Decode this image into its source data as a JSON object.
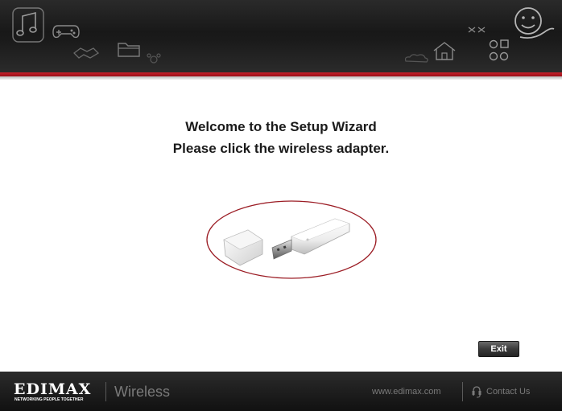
{
  "header": {
    "icons": [
      "music-note-icon",
      "gamepad-icon",
      "handshake-icon",
      "folder-icon",
      "paw-icon",
      "truck-icon",
      "house-icon",
      "network-icon",
      "cloud-icon",
      "smiley-icon"
    ]
  },
  "main": {
    "title": "Welcome to the Setup Wizard",
    "subtitle": "Please click the wireless adapter.",
    "adapter_icon": "usb-wireless-adapter-icon"
  },
  "actions": {
    "exit_label": "Exit"
  },
  "footer": {
    "brand_name": "EDIMAX",
    "brand_tagline": "NETWORKING PEOPLE TOGETHER",
    "product": "Wireless",
    "website": "www.edimax.com",
    "contact_label": "Contact Us"
  },
  "colors": {
    "accent_red": "#c6212b",
    "highlight_ellipse": "#9b1c24",
    "header_bg": "#1a1a1a",
    "footer_bg": "#1c1c1c"
  }
}
